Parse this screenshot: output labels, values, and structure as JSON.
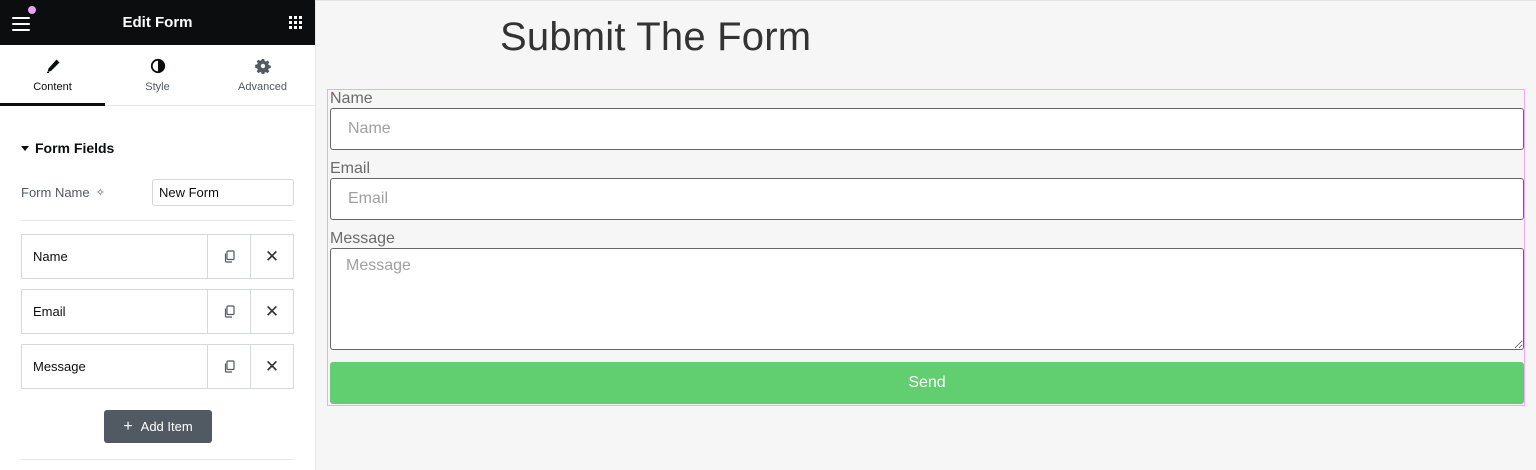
{
  "colors": {
    "accent_dot": "#e6a3f0",
    "send_button": "#61ce70",
    "form_outline": "#f2a8f3"
  },
  "topbar": {
    "title": "Edit Form",
    "menu_icon": "hamburger-menu-icon",
    "apps_icon": "grid-apps-icon"
  },
  "tabs": [
    {
      "label": "Content",
      "icon": "pencil-icon"
    },
    {
      "label": "Style",
      "icon": "contrast-icon"
    },
    {
      "label": "Advanced",
      "icon": "gear-icon"
    }
  ],
  "panel": {
    "section_title": "Form Fields",
    "form_name_label": "Form Name",
    "form_name_value": "New Form",
    "items": [
      {
        "label": "Name"
      },
      {
        "label": "Email"
      },
      {
        "label": "Message"
      }
    ],
    "add_item_label": "Add Item",
    "collapse_glyph": "‹"
  },
  "preview": {
    "heading": "Submit The Form",
    "fields": {
      "name": {
        "label": "Name",
        "placeholder": "Name"
      },
      "email": {
        "label": "Email",
        "placeholder": "Email"
      },
      "message": {
        "label": "Message",
        "placeholder": "Message"
      }
    },
    "send_label": "Send"
  }
}
